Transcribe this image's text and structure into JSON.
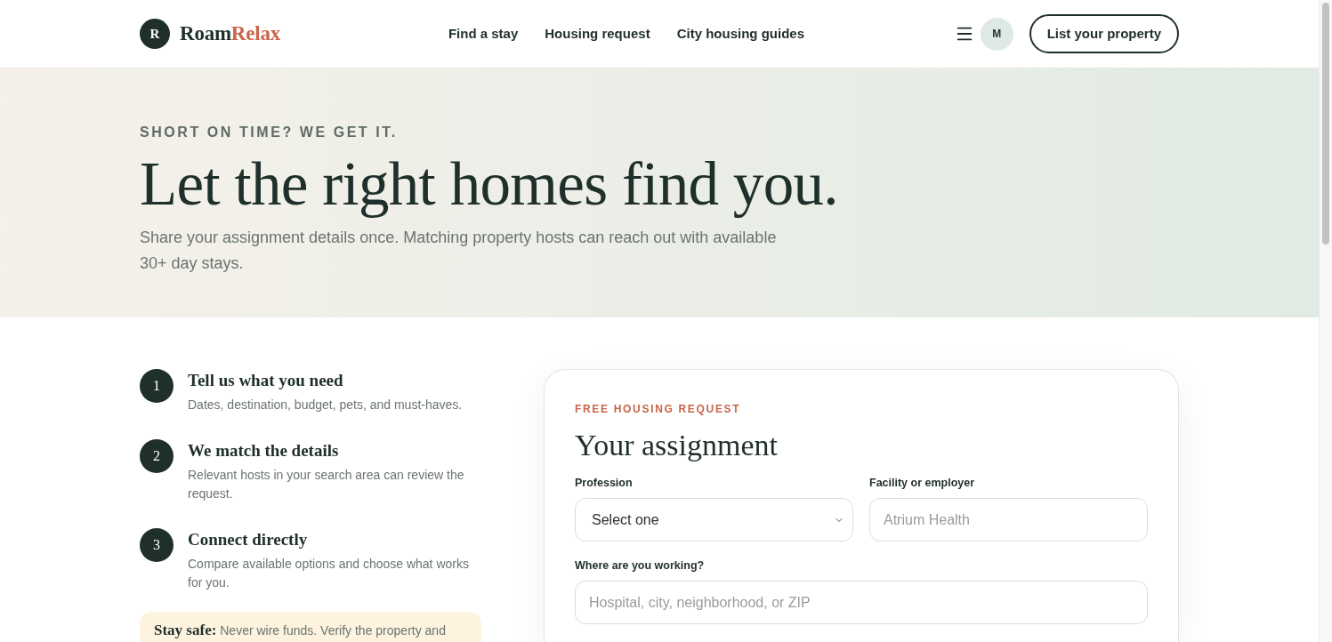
{
  "header": {
    "logo": {
      "mark": "R",
      "brand_first": "Roam",
      "brand_second": "Relax"
    },
    "nav": [
      {
        "label": "Find a stay"
      },
      {
        "label": "Housing request"
      },
      {
        "label": "City housing guides"
      }
    ],
    "avatar": "M",
    "cta": "List your property"
  },
  "hero": {
    "eyebrow": "SHORT ON TIME? WE GET IT.",
    "title": "Let the right homes find you.",
    "subtitle": "Share your assignment details once. Matching property hosts can reach out with available 30+ day stays."
  },
  "steps": [
    {
      "number": "1",
      "title": "Tell us what you need",
      "description": "Dates, destination, budget, pets, and must-haves."
    },
    {
      "number": "2",
      "title": "We match the details",
      "description": "Relevant hosts in your search area can review the request."
    },
    {
      "number": "3",
      "title": "Connect directly",
      "description": "Compare available options and choose what works for you."
    }
  ],
  "safety_note": {
    "text": "**Stay safe:** Never wire funds. Verify the property and"
  },
  "form": {
    "eyebrow": "FREE HOUSING REQUEST",
    "title": "Your assignment",
    "rows": [
      [
        {
          "kind": "select",
          "label": "Profession",
          "value": "Select one"
        },
        {
          "kind": "text",
          "label": "Facility or employer",
          "placeholder": "Atrium Health"
        }
      ],
      [
        {
          "kind": "text",
          "label": "Where are you working?",
          "placeholder": "Hospital, city, neighborhood, or ZIP"
        }
      ]
    ]
  }
}
